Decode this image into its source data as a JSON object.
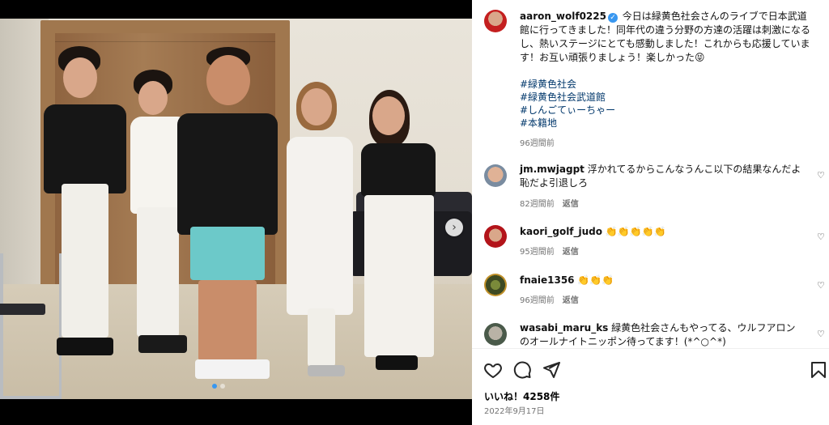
{
  "post": {
    "author": "aaron_wolf0225",
    "caption": "今日は緑黄色社会さんのライブで日本武道館に行ってきました！同年代の違う分野の方達の活躍は刺激になるし、熱いステージにとても感動しました！これからも応援しています！お互い頑張りましょう！楽しかった😝",
    "hashtags": [
      "#緑黄色社会",
      "#緑黄色社会武道館",
      "#しんごてぃーちゃー",
      "#本籍地"
    ],
    "time": "96週間前"
  },
  "comments": [
    {
      "user": "jm.mwjagpt",
      "text": "浮かれてるからこんなうんこ以下の結果なんだよ恥だよ引退しろ",
      "time": "82週間前",
      "reply": "返信"
    },
    {
      "user": "kaori_golf_judo",
      "text": "👏👏👏👏👏",
      "time": "95週間前",
      "reply": "返信"
    },
    {
      "user": "fnaie1356",
      "text": "👏👏👏",
      "time": "96週間前",
      "reply": "返信"
    },
    {
      "user": "wasabi_maru_ks",
      "text": "緑黄色社会さんもやってる、ウルフアロンのオールナイトニッポン待ってます！(*^○^*)",
      "time": "",
      "reply": ""
    }
  ],
  "likes": "いいね！4258件",
  "date": "2022年9月17日",
  "icons": {
    "like": "heart-icon",
    "comment": "comment-icon",
    "share": "send-icon",
    "save": "bookmark-icon",
    "next": "chevron-right-icon",
    "verified": "verified-badge-icon"
  },
  "colors": {
    "link": "#00376b",
    "accent": "#3897f0",
    "muted": "#737373"
  },
  "carousel": {
    "slides": 2,
    "active": 1
  }
}
